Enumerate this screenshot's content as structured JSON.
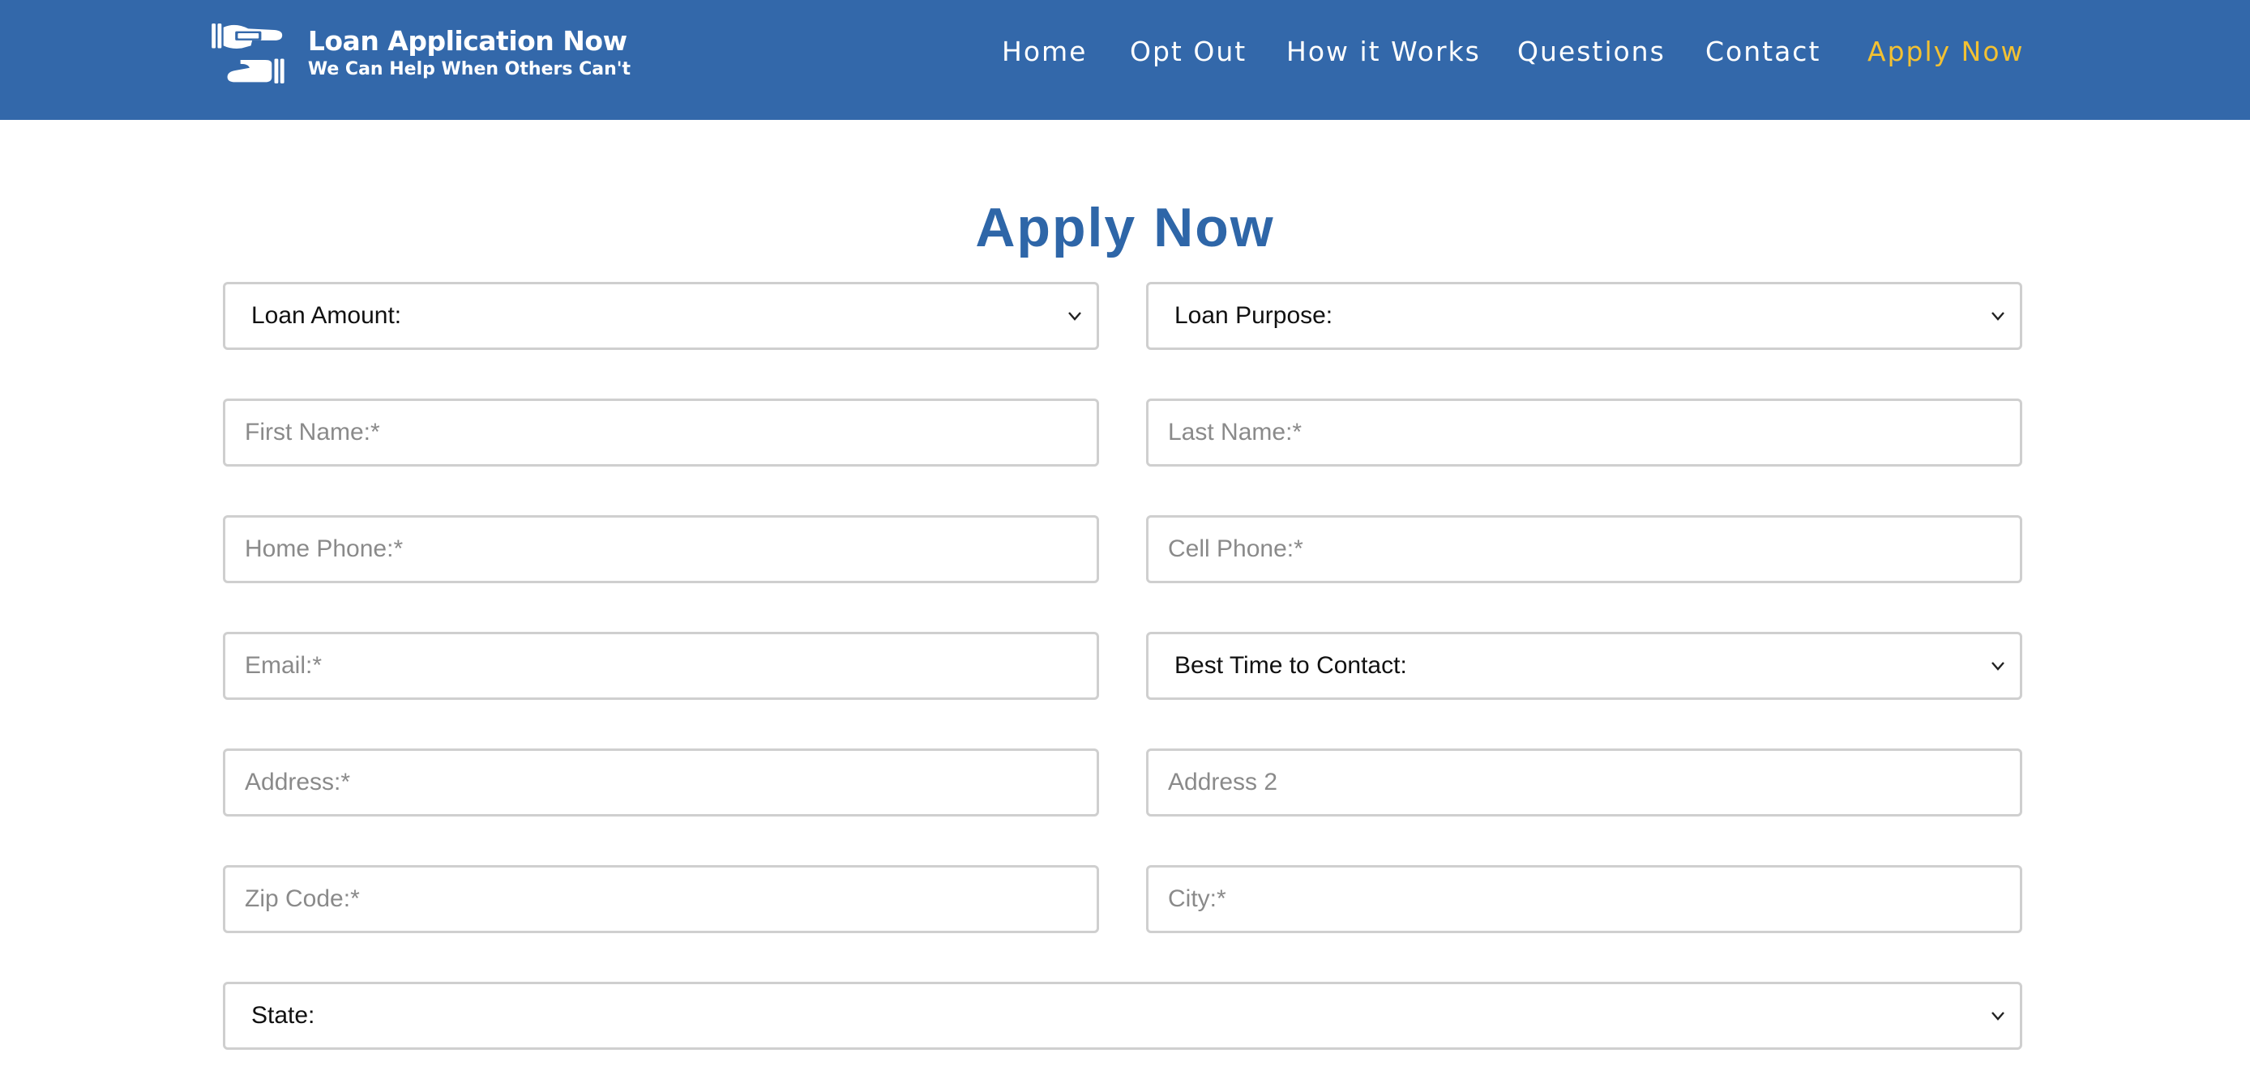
{
  "brand": {
    "name": "Loan Application Now",
    "tagline": "We Can Help When Others Can't",
    "logo_icon": "hands-exchanging-money-icon"
  },
  "nav": {
    "items": [
      {
        "label": "Home"
      },
      {
        "label": "Opt Out"
      },
      {
        "label": "How it Works"
      },
      {
        "label": "Questions"
      },
      {
        "label": "Contact"
      },
      {
        "label": "Apply Now",
        "active": true
      }
    ]
  },
  "colors": {
    "header_bg": "#3368aa",
    "nav_active": "#f3c132",
    "title": "#2e66a8",
    "field_border": "#cfcfcf"
  },
  "form": {
    "title": "Apply Now",
    "loan_amount": {
      "value": "Loan Amount:"
    },
    "loan_purpose": {
      "value": "Loan Purpose:"
    },
    "first_name": {
      "placeholder": "First Name:*",
      "value": ""
    },
    "last_name": {
      "placeholder": "Last Name:*",
      "value": ""
    },
    "home_phone": {
      "placeholder": "Home Phone:*",
      "value": ""
    },
    "cell_phone": {
      "placeholder": "Cell Phone:*",
      "value": ""
    },
    "email": {
      "placeholder": "Email:*",
      "value": ""
    },
    "best_time": {
      "value": "Best Time to Contact:"
    },
    "address": {
      "placeholder": "Address:*",
      "value": ""
    },
    "address2": {
      "placeholder": "Address 2",
      "value": ""
    },
    "zip": {
      "placeholder": "Zip Code:*",
      "value": ""
    },
    "city": {
      "placeholder": "City:*",
      "value": ""
    },
    "state": {
      "value": "State:"
    }
  }
}
